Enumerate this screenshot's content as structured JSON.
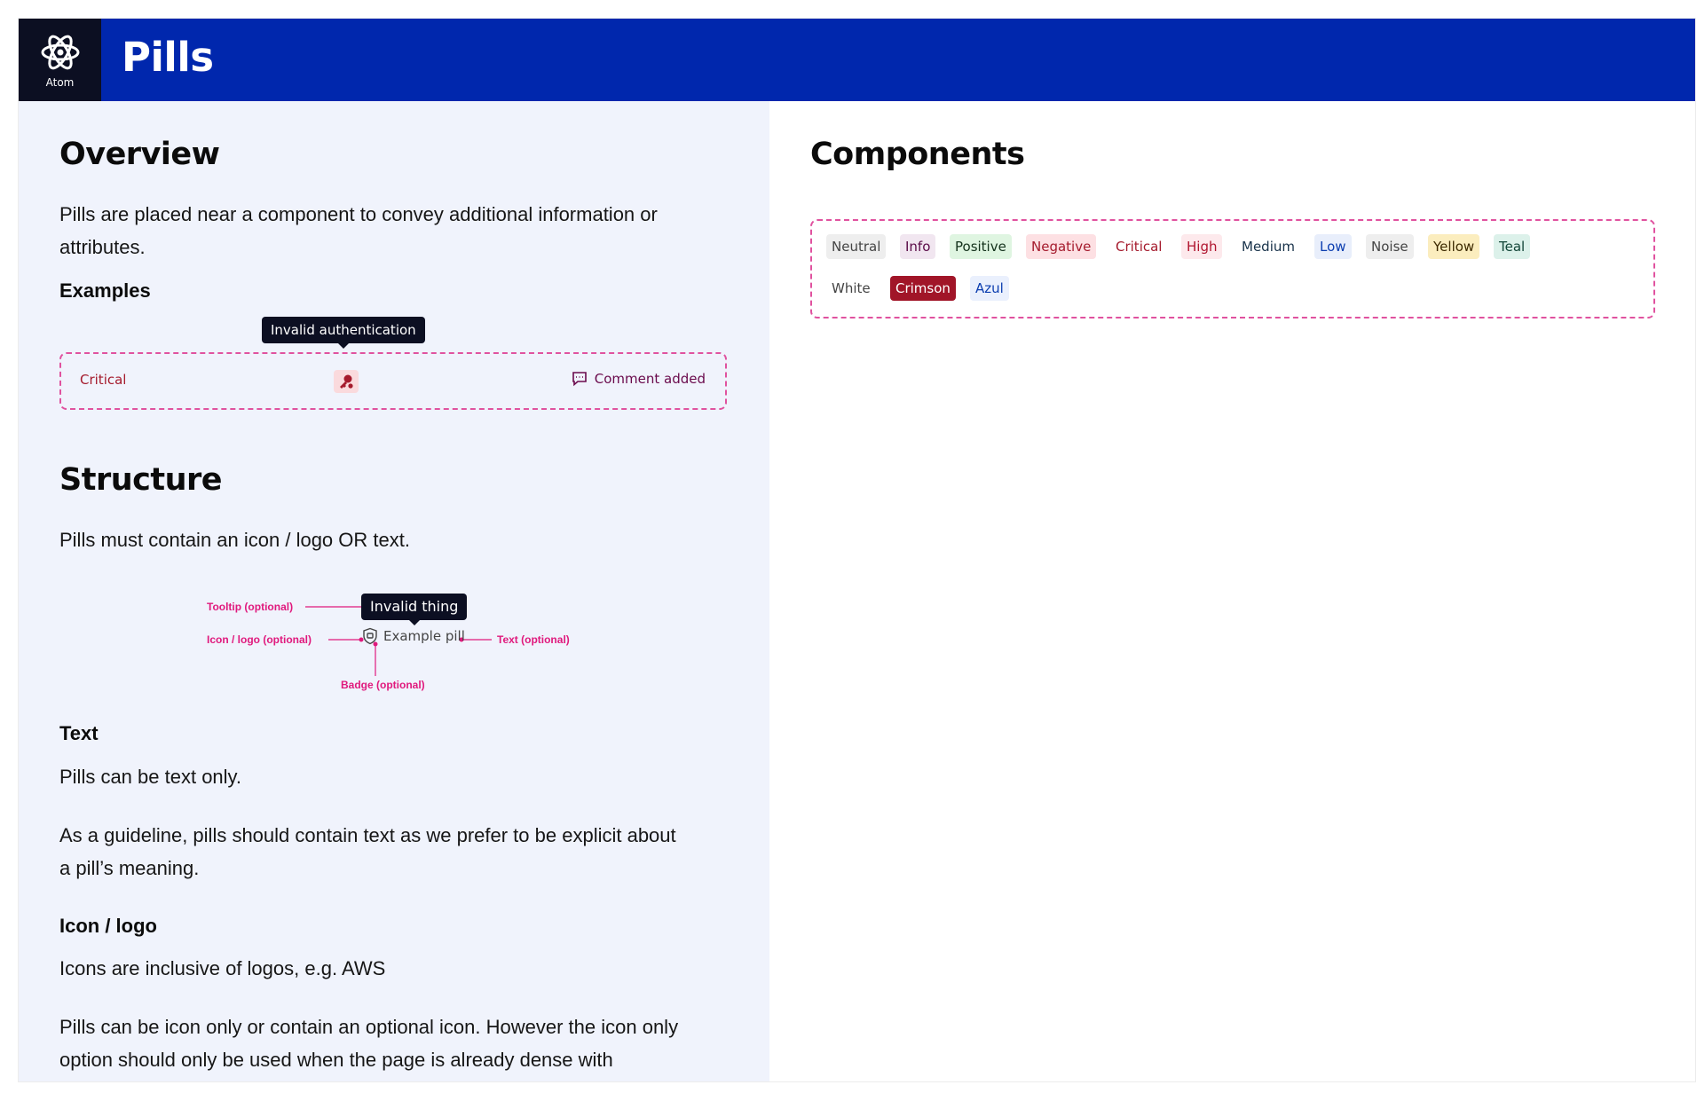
{
  "header": {
    "logo_label": "Atom",
    "title": "Pills"
  },
  "overview": {
    "heading": "Overview",
    "description_line1": "Pills are placed near a component to convey additional information or",
    "description_line2": "attributes.",
    "examples_heading": "Examples",
    "example_critical": "Critical",
    "example_tooltip": "Invalid authentication",
    "example_comment": "Comment added"
  },
  "structure": {
    "heading": "Structure",
    "description": "Pills must contain an icon / logo OR text.",
    "tooltip_label": "Tooltip (optional)",
    "tooltip_text": "Invalid thing",
    "icon_label": "Icon / logo (optional)",
    "pill_text": "Example pill",
    "text_label": "Text (optional)",
    "badge_label": "Badge (optional)"
  },
  "text_section": {
    "heading": "Text",
    "p1": "Pills can be text only.",
    "p2_line1": "As a guideline, pills should contain text as we prefer to be explicit about",
    "p2_line2": "a pill’s meaning."
  },
  "icon_section": {
    "heading": "Icon / logo",
    "p1": "Icons are inclusive of logos, e.g. AWS",
    "p2_line1": "Pills can be icon only or contain an optional icon. However the icon only",
    "p2_line2": "option should only be used when the page is already dense with"
  },
  "components": {
    "heading": "Components",
    "pills": [
      {
        "label": "Neutral",
        "bg": "#eeeeee",
        "fg": "#444444"
      },
      {
        "label": "Info",
        "bg": "#f1e6f0",
        "fg": "#5a0a47"
      },
      {
        "label": "Positive",
        "bg": "#dff5e1",
        "fg": "#14321c"
      },
      {
        "label": "Negative",
        "bg": "#fde0e3",
        "fg": "#a51b2d"
      },
      {
        "label": "Critical",
        "bg": "#ffffff",
        "fg": "#a51b2d"
      },
      {
        "label": "High",
        "bg": "#fde9ec",
        "fg": "#b0142e"
      },
      {
        "label": "Medium",
        "bg": "#ffffff",
        "fg": "#18324a"
      },
      {
        "label": "Low",
        "bg": "#e8eefb",
        "fg": "#0c3eb0"
      },
      {
        "label": "Noise",
        "bg": "#eeeeee",
        "fg": "#444444"
      },
      {
        "label": "Yellow",
        "bg": "#fbedbe",
        "fg": "#3d2a00"
      },
      {
        "label": "Teal",
        "bg": "#dcf1ea",
        "fg": "#104436"
      },
      {
        "label": "White",
        "bg": "#ffffff",
        "fg": "#444444"
      },
      {
        "label": "Crimson",
        "bg": "#a11528",
        "fg": "#ffffff"
      },
      {
        "label": "Azul",
        "bg": "#eaf0fd",
        "fg": "#0c3eb0"
      }
    ]
  },
  "colors": {
    "header_bg": "#0027ad",
    "accent_pink": "#e0197d",
    "sidebar_bg": "#f0f3fc"
  }
}
